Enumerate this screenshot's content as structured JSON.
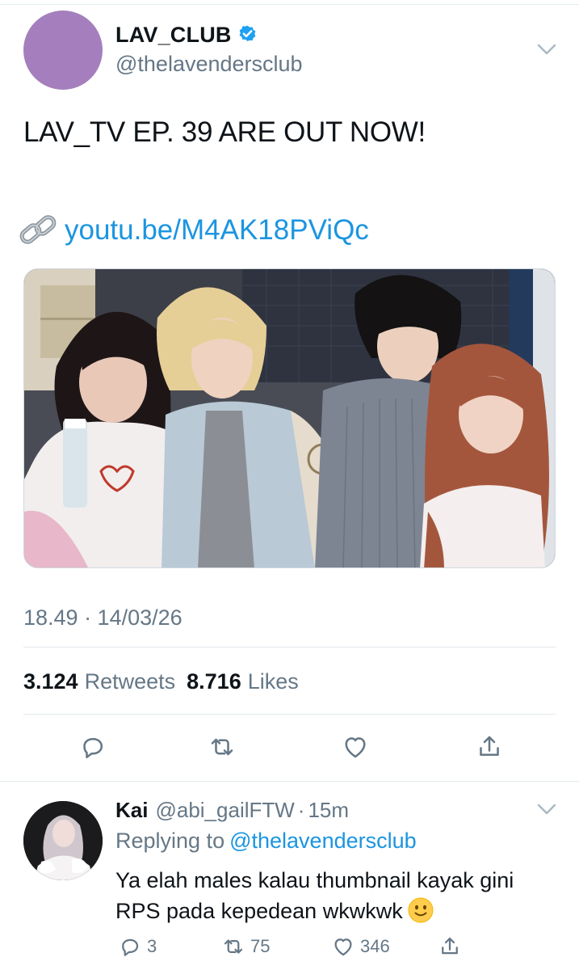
{
  "tweet": {
    "display_name": "LAV_CLUB",
    "handle": "@thelavendersclub",
    "text": "LAV_TV EP. 39 ARE OUT NOW!",
    "link": "youtu.be/M4AK18PViQc",
    "timestamp": "18.49 · 14/03/26",
    "retweet_count": "3.124",
    "retweet_label": "Retweets",
    "like_count": "8.716",
    "like_label": "Likes",
    "avatar_color": "#a57fbd",
    "accent_color": "#1b95e0",
    "icons": [
      "verified-badge-icon",
      "chevron-down-icon",
      "link-icon",
      "reply-icon",
      "retweet-icon",
      "like-icon",
      "share-icon"
    ]
  },
  "reply": {
    "display_name": "Kai",
    "handle": "@abi_gailFTW",
    "separator": "·",
    "time": "15m",
    "replying_prefix": "Replying to",
    "replying_to": "@thelavendersclub",
    "text_line1": "Ya elah males kalau thumbnail kayak gini",
    "text_line2": "RPS pada kepedean wkwkwk",
    "reply_count": "3",
    "retweet_count": "75",
    "like_count": "346",
    "icons": [
      "smile-emoji-icon",
      "chevron-down-icon",
      "reply-icon",
      "retweet-icon",
      "like-icon",
      "share-icon"
    ]
  },
  "colors": {
    "text": "#0f1419",
    "secondary": "#657786",
    "link": "#1b95e0",
    "divider": "#e1e8ed"
  }
}
